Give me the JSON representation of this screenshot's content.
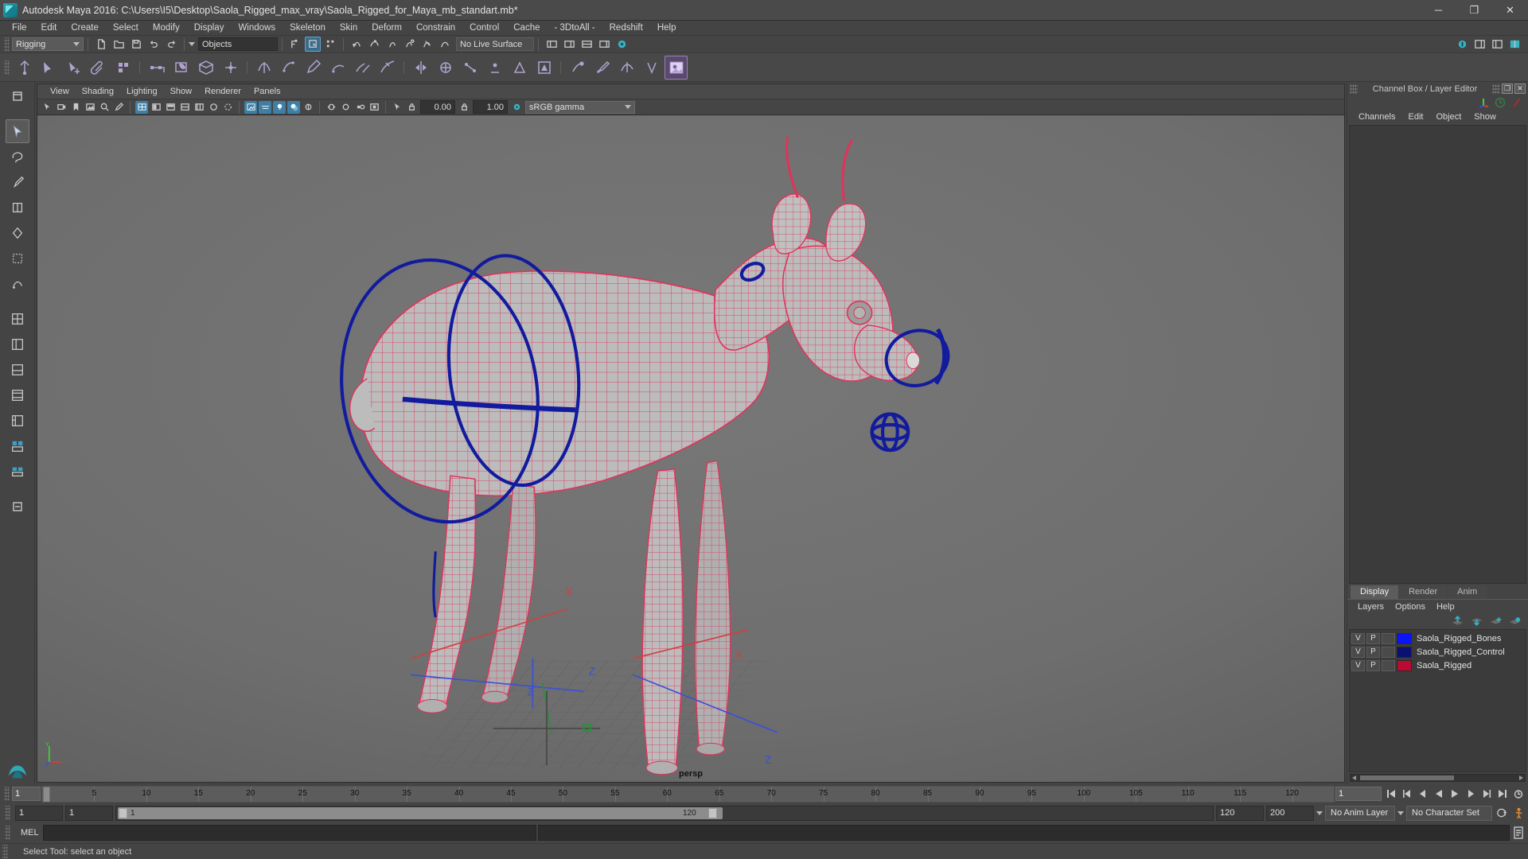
{
  "window": {
    "title": "Autodesk Maya 2016: C:\\Users\\I5\\Desktop\\Saola_Rigged_max_vray\\Saola_Rigged_for_Maya_mb_standart.mb*",
    "app_icon": "maya-icon",
    "minimize": "─",
    "maximize": "❐",
    "close": "✕"
  },
  "menubar": {
    "items": [
      {
        "label": "File"
      },
      {
        "label": "Edit"
      },
      {
        "label": "Create"
      },
      {
        "label": "Select"
      },
      {
        "label": "Modify"
      },
      {
        "label": "Display"
      },
      {
        "label": "Windows"
      },
      {
        "label": "Skeleton"
      },
      {
        "label": "Skin"
      },
      {
        "label": "Deform"
      },
      {
        "label": "Constrain"
      },
      {
        "label": "Control"
      },
      {
        "label": "Cache"
      },
      {
        "label": "- 3DtoAll -"
      },
      {
        "label": "Redshift"
      },
      {
        "label": "Help"
      }
    ]
  },
  "statusline": {
    "menu_set": "Rigging",
    "selection_mask": "Objects",
    "live_surface": "No Live Surface",
    "numeric_input_1": "0.00",
    "numeric_input_2": "1.00"
  },
  "viewport_panel": {
    "menus": [
      {
        "label": "View"
      },
      {
        "label": "Shading"
      },
      {
        "label": "Lighting"
      },
      {
        "label": "Show"
      },
      {
        "label": "Renderer"
      },
      {
        "label": "Panels"
      }
    ],
    "exposure": "0.00",
    "gamma": "1.00",
    "color_profile": "sRGB gamma",
    "camera_label": "persp",
    "axis_x": "X",
    "axis_y": "Y",
    "axis_z": "Z"
  },
  "channel_box": {
    "panel_title": "Channel Box / Layer Editor",
    "menus": [
      {
        "label": "Channels"
      },
      {
        "label": "Edit"
      },
      {
        "label": "Object"
      },
      {
        "label": "Show"
      }
    ],
    "restore_glyph": "❐",
    "close_glyph": "✕"
  },
  "layer_editor": {
    "tabs": [
      {
        "label": "Display",
        "active": true
      },
      {
        "label": "Render",
        "active": false
      },
      {
        "label": "Anim",
        "active": false
      }
    ],
    "menus": [
      {
        "label": "Layers"
      },
      {
        "label": "Options"
      },
      {
        "label": "Help"
      }
    ],
    "column_v": "V",
    "column_p": "P",
    "layers": [
      {
        "visible": "V",
        "playback": "P",
        "color": "#0b14f5",
        "name": "Saola_Rigged_Bones"
      },
      {
        "visible": "V",
        "playback": "P",
        "color": "#0a1172",
        "name": "Saola_Rigged_Control"
      },
      {
        "visible": "V",
        "playback": "P",
        "color": "#bb0b35",
        "name": "Saola_Rigged"
      }
    ]
  },
  "timeline": {
    "current_frame_field": "1",
    "current_frame_marker": "1",
    "ticks": [
      5,
      10,
      15,
      20,
      25,
      30,
      35,
      40,
      45,
      50,
      55,
      60,
      65,
      70,
      75,
      80,
      85,
      90,
      95,
      100,
      105,
      110,
      115,
      120
    ],
    "end_display": "1",
    "range_start": "1",
    "range_end": "1",
    "range_bar_start": "1",
    "range_bar_end": "120",
    "anim_end": "120",
    "playback_end": "200",
    "anim_layer": "No Anim Layer",
    "character_set": "No Character Set"
  },
  "command_line": {
    "language": "MEL",
    "input_value": "",
    "output_value": ""
  },
  "status_bar": {
    "message": "Select Tool: select an object"
  },
  "colors": {
    "mesh_wire": "#e0335c",
    "mesh_fill": "#b9b9b9",
    "control_curve": "#121b9e",
    "viewport_bg": "#6e6e6e",
    "accent_blue": "#3e7fa6",
    "accent_teal": "#33b4c4"
  }
}
